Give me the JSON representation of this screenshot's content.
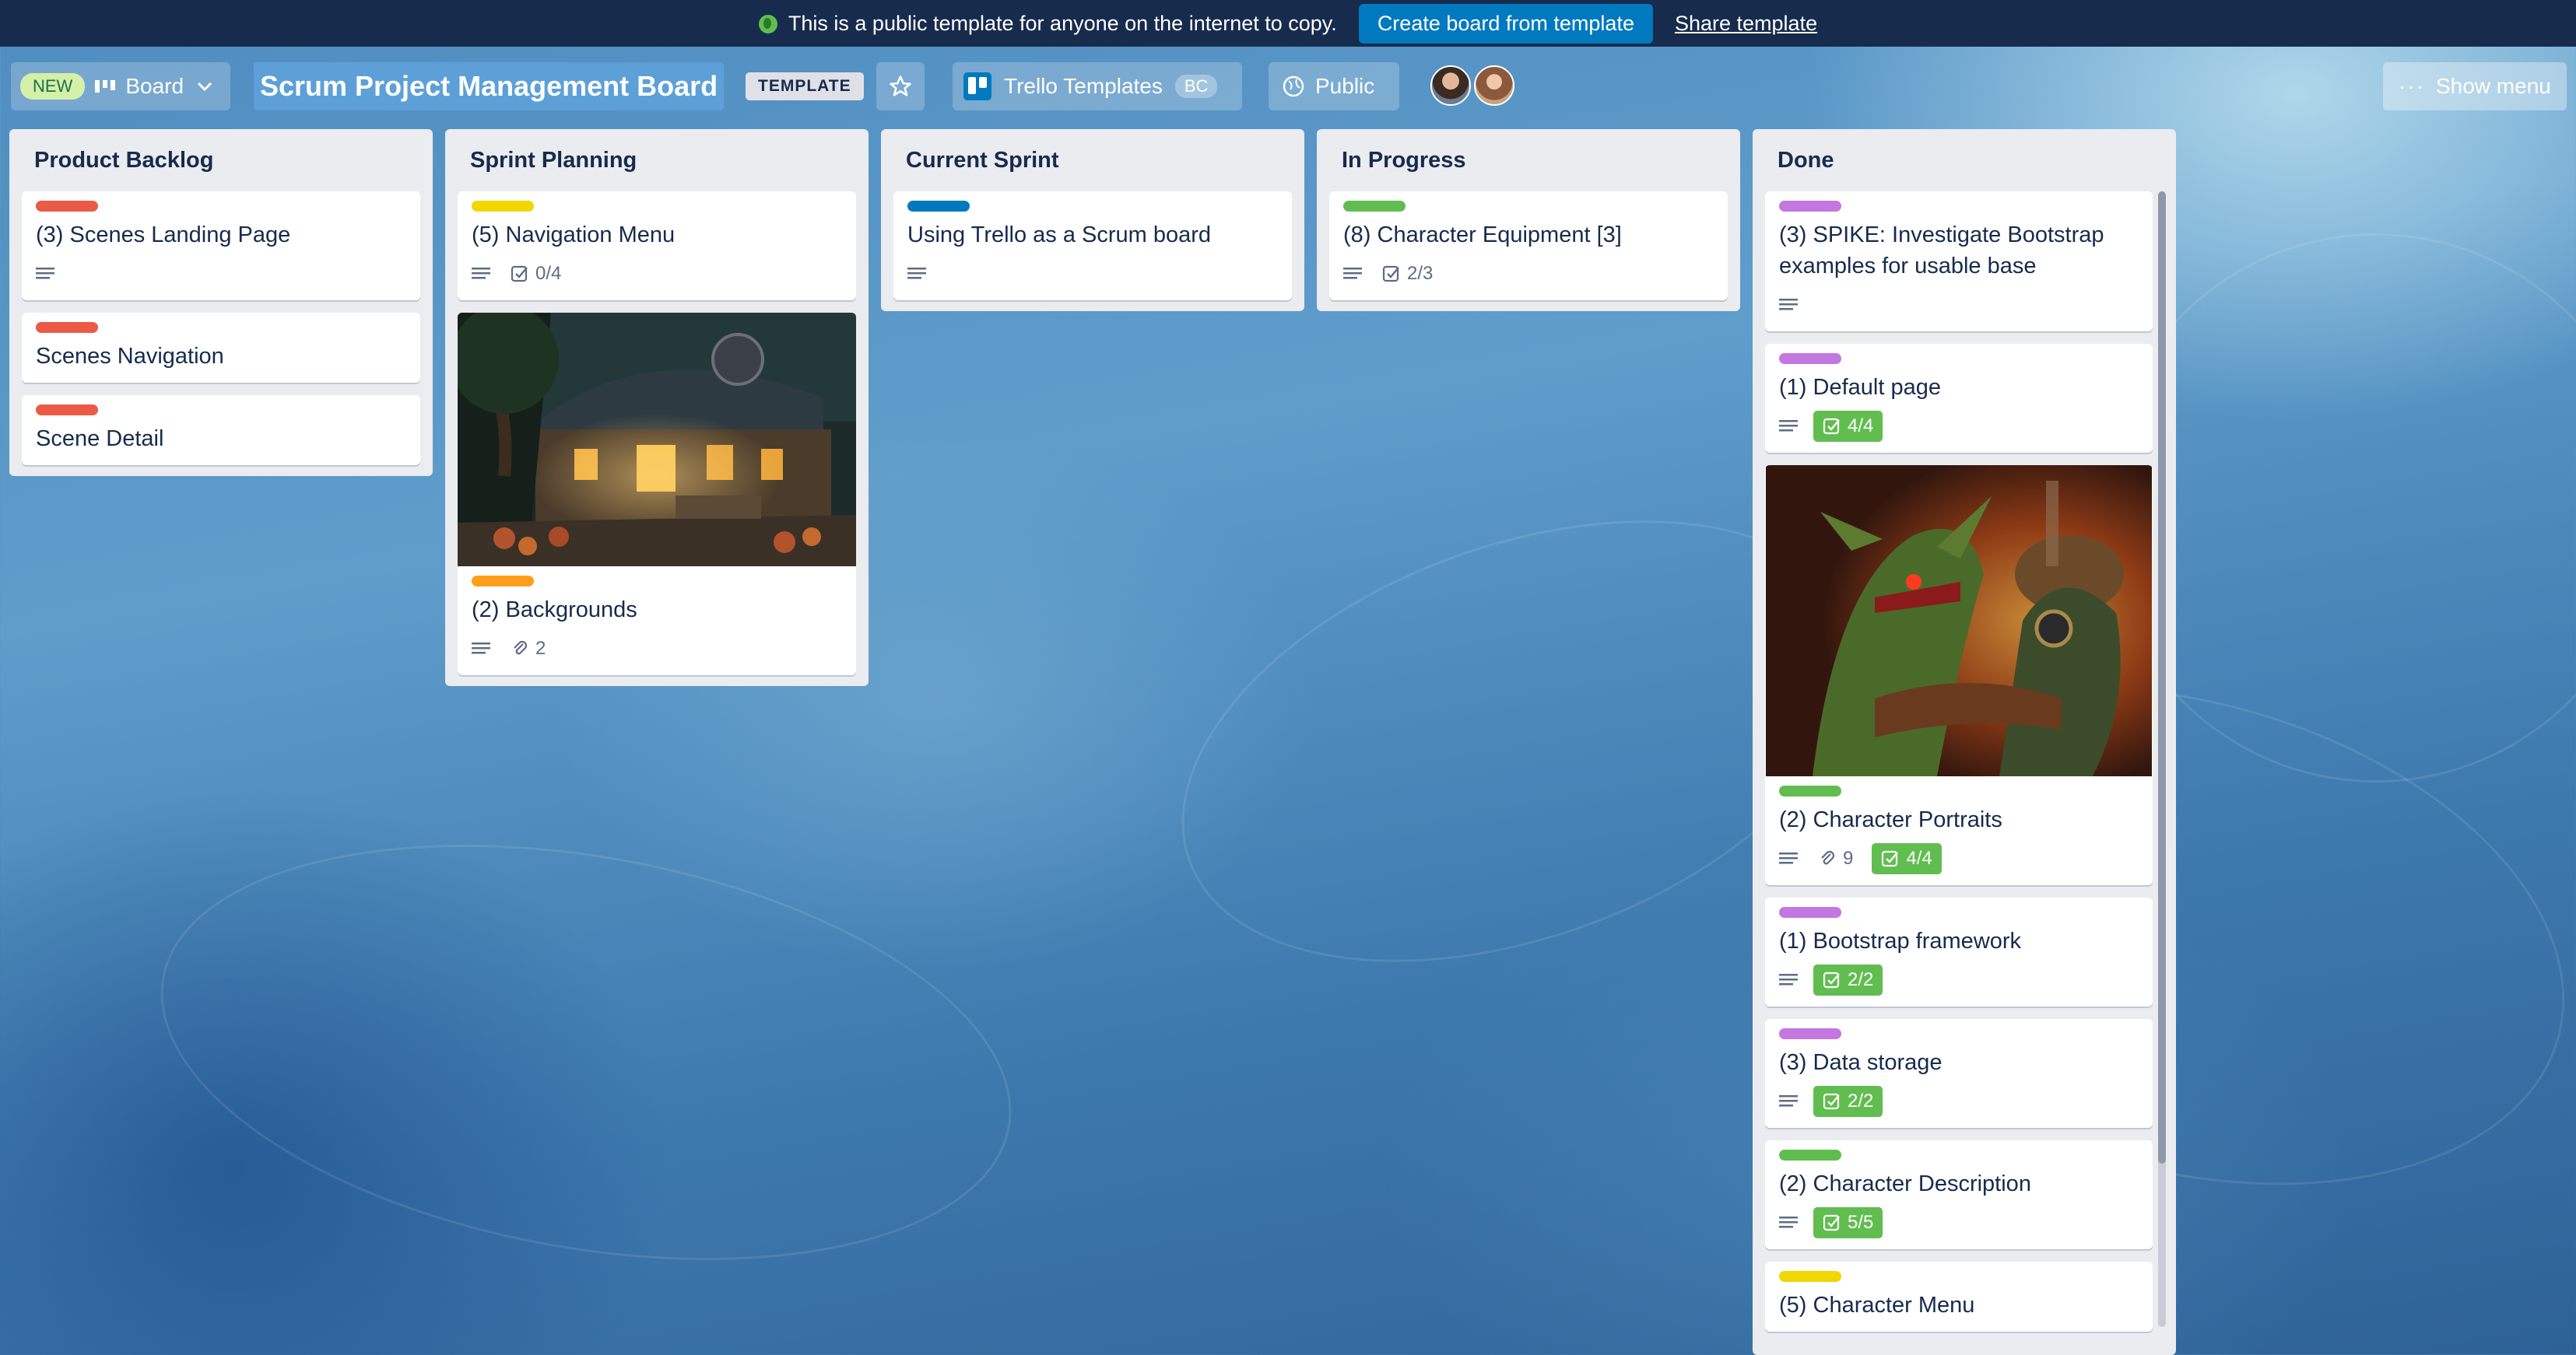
{
  "banner": {
    "message": "This is a public template for anyone on the internet to copy.",
    "create_label": "Create board from template",
    "share_label": "Share template"
  },
  "header": {
    "new_badge": "NEW",
    "view_label": "Board",
    "board_title": "Scrum Project Management Board",
    "template_badge": "TEMPLATE",
    "workspace_label": "Trello Templates",
    "workspace_badge": "BC",
    "visibility_label": "Public",
    "show_menu_label": "Show menu"
  },
  "colors": {
    "red": "#eb5a46",
    "yellow": "#f2d600",
    "blue": "#0079bf",
    "green": "#61bd4f",
    "orange": "#ff9f1a",
    "purple": "#c377e0"
  },
  "lists": [
    {
      "title": "Product Backlog",
      "cards": [
        {
          "title": "(3) Scenes Landing Page",
          "label": "red",
          "desc": true
        },
        {
          "title": "Scenes Navigation",
          "label": "red"
        },
        {
          "title": "Scene Detail",
          "label": "red"
        }
      ]
    },
    {
      "title": "Sprint Planning",
      "cards": [
        {
          "title": "(5) Navigation Menu",
          "label": "yellow",
          "desc": true,
          "checklist": "0/4"
        },
        {
          "title": "(2) Backgrounds",
          "label": "orange",
          "desc": true,
          "attachments": "2",
          "cover": "cottage-night-scene"
        }
      ]
    },
    {
      "title": "Current Sprint",
      "cards": [
        {
          "title": "Using Trello as a Scrum board",
          "label": "blue",
          "desc": true
        }
      ]
    },
    {
      "title": "In Progress",
      "cards": [
        {
          "title": "(8) Character Equipment [3]",
          "label": "green",
          "desc": true,
          "checklist": "2/3"
        }
      ]
    },
    {
      "title": "Done",
      "cards": [
        {
          "title": "(3) SPIKE: Investigate Bootstrap examples for usable base",
          "label": "purple",
          "desc": true
        },
        {
          "title": "(1) Default page",
          "label": "purple",
          "desc": true,
          "checklist": "4/4",
          "done": true
        },
        {
          "title": "(2) Character Portraits",
          "label": "green",
          "desc": true,
          "attachments": "9",
          "checklist": "4/4",
          "done": true,
          "cover": "goblin-portrait"
        },
        {
          "title": "(1) Bootstrap framework",
          "label": "purple",
          "desc": true,
          "checklist": "2/2",
          "done": true
        },
        {
          "title": "(3) Data storage",
          "label": "purple",
          "desc": true,
          "checklist": "2/2",
          "done": true
        },
        {
          "title": "(2) Character Description",
          "label": "green",
          "desc": true,
          "checklist": "5/5",
          "done": true
        },
        {
          "title": "(5) Character Menu",
          "label": "yellow"
        }
      ]
    }
  ]
}
